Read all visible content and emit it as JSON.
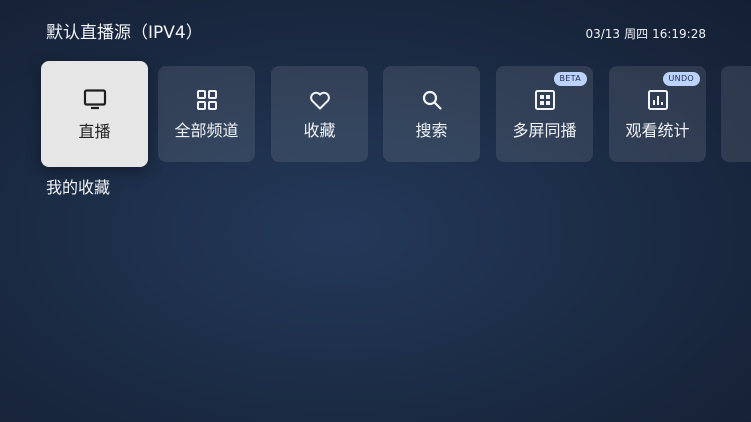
{
  "header": {
    "title": "默认直播源（IPV4）",
    "date": "03/13",
    "weekday": "周四",
    "time": "16:19:28"
  },
  "menu": {
    "items": [
      {
        "label": "直播",
        "icon": "tv-icon",
        "active": true
      },
      {
        "label": "全部频道",
        "icon": "grid-icon"
      },
      {
        "label": "收藏",
        "icon": "heart-icon"
      },
      {
        "label": "搜索",
        "icon": "search-icon"
      },
      {
        "label": "多屏同播",
        "icon": "multiscreen-icon",
        "badge": "BETA"
      },
      {
        "label": "观看统计",
        "icon": "chart-icon",
        "badge": "UNDO"
      },
      {
        "label": "",
        "icon": "",
        "partial": true
      }
    ]
  },
  "section": {
    "title": "我的收藏"
  },
  "colors": {
    "background_dark": "#141f33",
    "background_light": "#24395a",
    "active_tile": "#e6e6e6",
    "badge": "#bcd3ff"
  }
}
